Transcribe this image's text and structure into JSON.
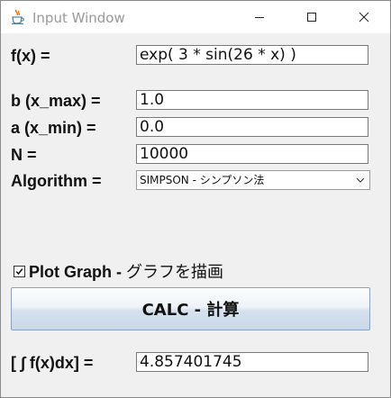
{
  "window": {
    "title": "Input Window"
  },
  "titlebar": {
    "app_icon": "java-icon",
    "minimize_icon": "minimize-icon",
    "maximize_icon": "maximize-icon",
    "close_icon": "close-icon"
  },
  "form": {
    "fx_label": "f(x) =",
    "fx_value": "exp( 3 * sin(26 * x) )",
    "b_label": "b (x_max) =",
    "b_value": "1.0",
    "a_label": "a (x_min) =",
    "a_value": "0.0",
    "n_label": "N =",
    "n_value": "10000",
    "algorithm_label": "Algorithm =",
    "algorithm_selected": "SIMPSON - シンプソン法"
  },
  "plot_checkbox": {
    "checked": true,
    "label_bold": "Plot Graph - ",
    "label_rest": "グラフを描画"
  },
  "calc_button": {
    "label": "CALC - 計算"
  },
  "result": {
    "label": "[ ∫ f(x)dx] =",
    "value": "4.857401745"
  }
}
